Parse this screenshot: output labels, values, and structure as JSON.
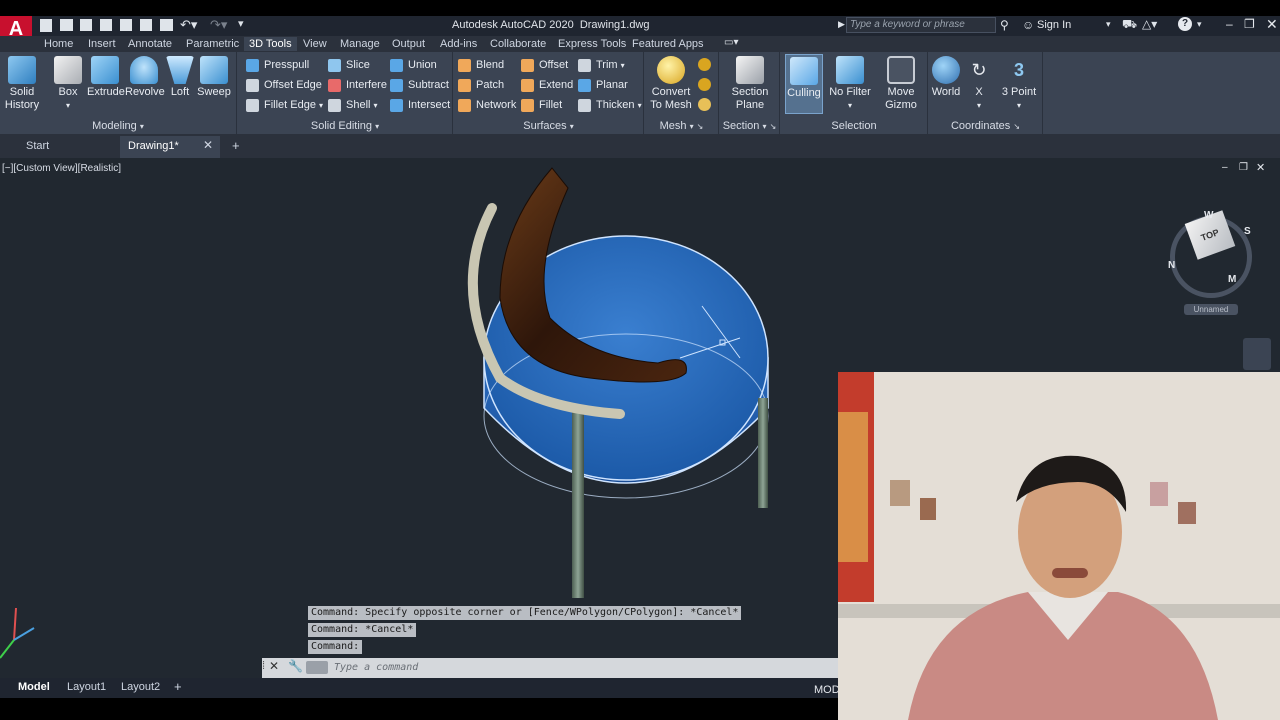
{
  "app": {
    "title": "Autodesk AutoCAD 2020",
    "file": "Drawing1.dwg",
    "search_placeholder": "Type a keyword or phrase",
    "sign_in": "Sign In"
  },
  "ribbon_tabs": [
    "Home",
    "Insert",
    "Annotate",
    "Parametric",
    "3D Tools",
    "View",
    "Manage",
    "Output",
    "Add-ins",
    "Collaborate",
    "Express Tools",
    "Featured Apps"
  ],
  "active_tab": "3D Tools",
  "panels": {
    "modeling": {
      "title": "Modeling",
      "buttons": [
        "Solid History",
        "Box",
        "Extrude",
        "Revolve",
        "Loft",
        "Sweep"
      ]
    },
    "solid_editing": {
      "title": "Solid Editing",
      "buttons": [
        "Presspull",
        "Slice",
        "Union",
        "Offset Edge",
        "Interfere",
        "Subtract",
        "Fillet Edge",
        "Shell",
        "Intersect"
      ]
    },
    "surfaces": {
      "title": "Surfaces",
      "buttons": [
        "Blend",
        "Offset",
        "Trim",
        "Patch",
        "Extend",
        "Planar",
        "Network",
        "Fillet",
        "Thicken"
      ]
    },
    "mesh": {
      "title": "Mesh",
      "buttons": [
        "Convert To Mesh"
      ]
    },
    "section": {
      "title": "Section",
      "buttons": [
        "Section Plane"
      ]
    },
    "selection": {
      "title": "Selection",
      "buttons": [
        "Culling",
        "No Filter",
        "Move Gizmo"
      ]
    },
    "coordinates": {
      "title": "Coordinates",
      "buttons": [
        "World",
        "X",
        "3 Point"
      ]
    }
  },
  "doc_tabs": {
    "start": "Start",
    "drawing": "Drawing1*"
  },
  "viewport": {
    "label": "[−][Custom View][Realistic]",
    "viewcube_face": "TOP",
    "viewcube_label": "Unnamed",
    "compass": {
      "w": "W",
      "s": "S",
      "n": "N",
      "e": "M"
    }
  },
  "command": {
    "history": [
      "Command: Specify opposite corner or [Fence/WPolygon/CPolygon]: *Cancel*",
      "Command: *Cancel*",
      "Command:"
    ],
    "input_placeholder": "Type a command"
  },
  "layouts": [
    "Model",
    "Layout1",
    "Layout2"
  ],
  "active_layout": "Model",
  "status": {
    "model": "MOD"
  },
  "colors": {
    "accent": "#0696d7",
    "ribbon_bg": "#3b4453",
    "viewport_bg": "#212830"
  }
}
